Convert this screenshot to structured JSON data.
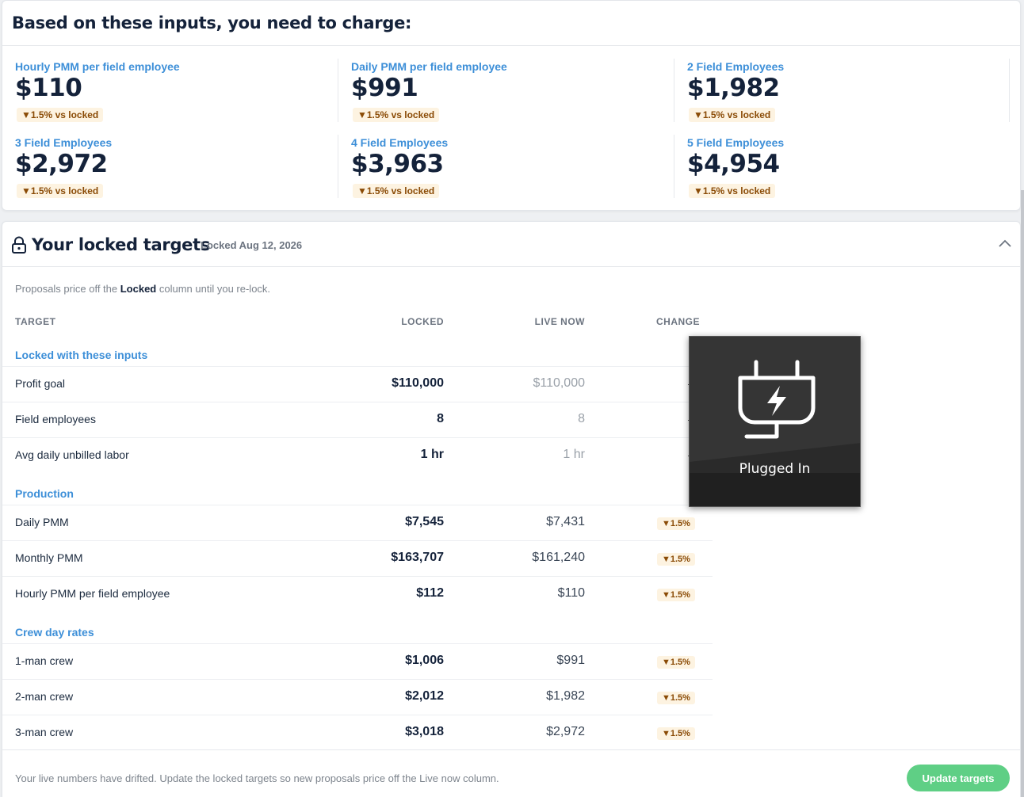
{
  "charge": {
    "title": "Based on these inputs, you need to charge:",
    "metrics": [
      {
        "label": "Hourly PMM per field employee",
        "value": "$110",
        "delta": "▼1.5% vs locked"
      },
      {
        "label": "Daily PMM per field employee",
        "value": "$991",
        "delta": "▼1.5% vs locked"
      },
      {
        "label": "2 Field Employees",
        "value": "$1,982",
        "delta": "▼1.5% vs locked"
      },
      {
        "label": "3 Field Employees",
        "value": "$2,972",
        "delta": "▼1.5% vs locked"
      },
      {
        "label": "4 Field Employees",
        "value": "$3,963",
        "delta": "▼1.5% vs locked"
      },
      {
        "label": "5 Field Employees",
        "value": "$4,954",
        "delta": "▼1.5% vs locked"
      }
    ]
  },
  "locked": {
    "title": "Your locked targets",
    "date": "Locked Aug 12, 2026",
    "intro_prefix": "Proposals price off the ",
    "intro_bold": "Locked",
    "intro_suffix": " column until you re-lock.",
    "columns": {
      "target": "TARGET",
      "locked": "LOCKED",
      "live": "LIVE NOW",
      "change": "CHANGE"
    },
    "sections": [
      {
        "label": "Locked with these inputs",
        "rows": [
          {
            "label": "Profit goal",
            "locked": "$110,000",
            "live": "$110,000",
            "change": ""
          },
          {
            "label": "Field employees",
            "locked": "8",
            "live": "8",
            "change": ""
          },
          {
            "label": "Avg daily unbilled labor",
            "locked": "1 hr",
            "live": "1 hr",
            "change": ""
          }
        ]
      },
      {
        "label": "Production",
        "rows": [
          {
            "label": "Daily PMM",
            "locked": "$7,545",
            "live": "$7,431",
            "change": "▼1.5%"
          },
          {
            "label": "Monthly PMM",
            "locked": "$163,707",
            "live": "$161,240",
            "change": "▼1.5%"
          },
          {
            "label": "Hourly PMM per field employee",
            "locked": "$112",
            "live": "$110",
            "change": "▼1.5%"
          }
        ]
      },
      {
        "label": "Crew day rates",
        "rows": [
          {
            "label": "1-man crew",
            "locked": "$1,006",
            "live": "$991",
            "change": "▼1.5%"
          },
          {
            "label": "2-man crew",
            "locked": "$2,012",
            "live": "$1,982",
            "change": "▼1.5%"
          },
          {
            "label": "3-man crew",
            "locked": "$3,018",
            "live": "$2,972",
            "change": "▼1.5%"
          }
        ]
      }
    ],
    "footer_note": "Your live numbers have drifted. Update the locked targets so new proposals price off the Live now column.",
    "update_button": "Update targets"
  },
  "toast": {
    "icon": "power-plug-icon",
    "text": "Plugged In"
  },
  "colors": {
    "accent_blue": "#3d8fd8",
    "navy": "#14223a",
    "delta_bg": "#fdf3e1",
    "delta_text": "#8a4b06",
    "button_green": "#5fcf85"
  }
}
